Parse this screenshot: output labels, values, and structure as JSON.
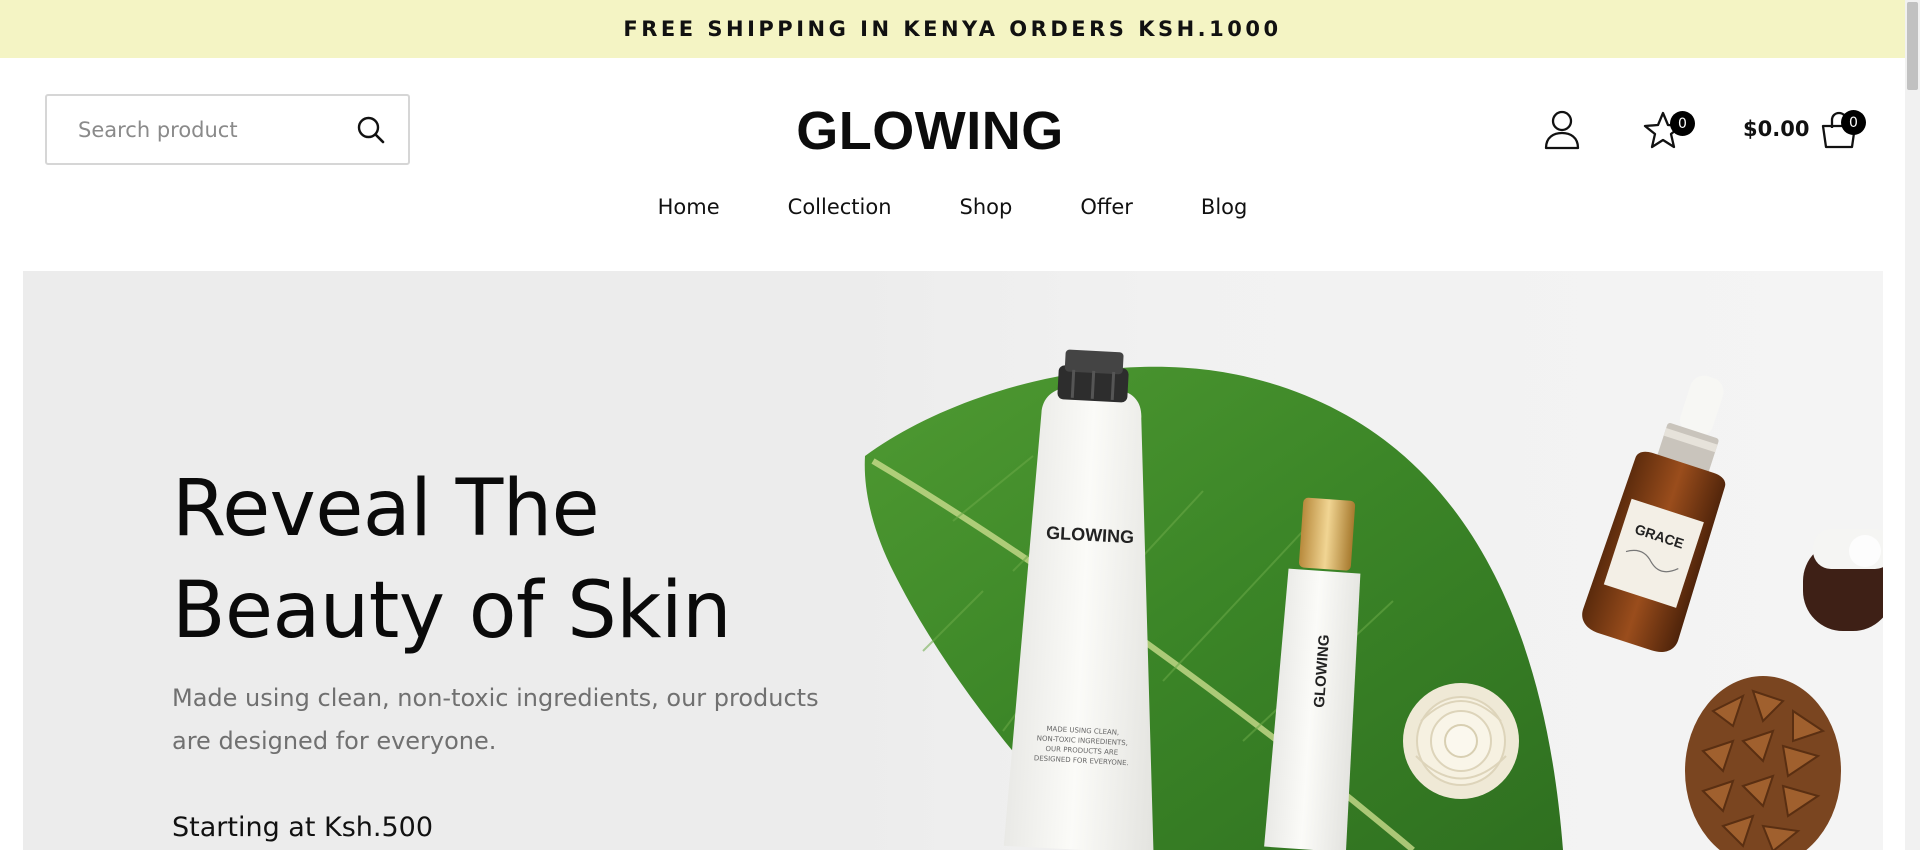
{
  "announcement": "FREE SHIPPING IN KENYA ORDERS KSH.1000",
  "header": {
    "search_placeholder": "Search product",
    "logo": "GLOWING",
    "wishlist_count": "0",
    "cart_total": "$0.00",
    "cart_count": "0",
    "icons": [
      "search-icon",
      "user-icon",
      "star-icon",
      "shopping-bag-icon"
    ]
  },
  "nav": {
    "items": [
      "Home",
      "Collection",
      "Shop",
      "Offer",
      "Blog"
    ]
  },
  "hero": {
    "headline_line1": "Reveal The",
    "headline_line2": "Beauty of Skin",
    "subtext": "Made using clean, non-toxic ingredients, our products are designed for everyone.",
    "starting_price": "Starting at Ksh.500",
    "product_labels": {
      "tube_brand": "GLOWING",
      "bottle_brand": "GLOWING",
      "dropper_brand": "GRACE",
      "tube_fineprint": "MADE USING CLEAN, NON-TOXIC INGREDIENTS, OUR PRODUCTS ARE DESIGNED FOR EVERYONE."
    }
  },
  "colors": {
    "announcement_bg": "#f4f4c4",
    "hero_bg": "#ececec",
    "leaf": "#3f8a2a",
    "text_muted": "#707070"
  }
}
